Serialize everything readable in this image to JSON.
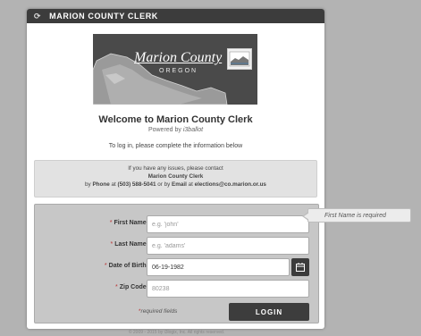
{
  "header": {
    "title": "MARION COUNTY CLERK",
    "logo_icon": "sync-arrows-icon"
  },
  "banner": {
    "county": "Marion County",
    "state": "OREGON"
  },
  "welcome": {
    "title": "Welcome to Marion County Clerk",
    "powered_prefix": "Powered by ",
    "powered_brand": "i3ballot"
  },
  "instructions": "To log in, please complete the information below",
  "info": {
    "line1": "If you have any issues, please contact",
    "line2": "Marion County Clerk",
    "line3_a": "by ",
    "phone_label": "Phone",
    "line3_b": " at ",
    "phone": "(503) 588-5041",
    "line3_c": " or by ",
    "email_label": "Email",
    "line3_d": " at ",
    "email": "elections@co.marion.or.us"
  },
  "form": {
    "required_marker": "*",
    "first_name": {
      "label": "First Name:",
      "value": "",
      "placeholder": "e.g. 'john'"
    },
    "last_name": {
      "label": "Last Name:",
      "value": "",
      "placeholder": "e.g. 'adams'"
    },
    "dob": {
      "label": "Date of Birth:",
      "value": "06-19-1982",
      "placeholder": ""
    },
    "zip": {
      "label": "Zip Code:",
      "value": "",
      "placeholder": "80238"
    },
    "required_note": "required fields",
    "login_label": "LOGIN"
  },
  "tooltip": "First Name is required",
  "footer": "© 2009 - 2015 by i3logix, Inc. All rights reserved.",
  "colors": {
    "header_bg": "#3c3c3c",
    "page_bg": "#b3b3b3",
    "form_bg": "#c7c7c7",
    "button_bg": "#3d3d3d",
    "required": "#b33333"
  }
}
